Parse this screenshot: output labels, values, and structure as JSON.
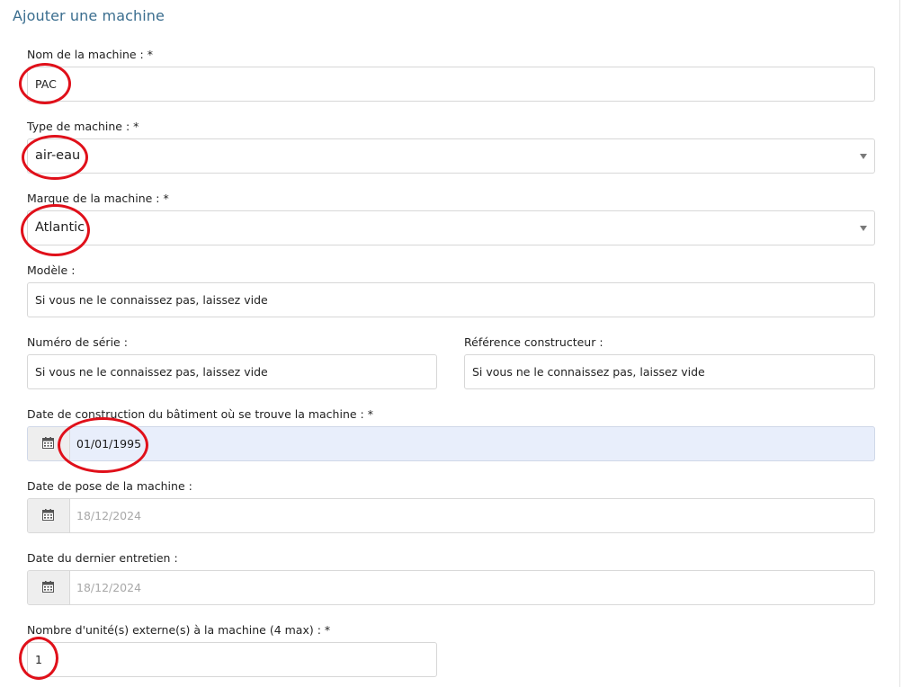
{
  "form": {
    "title": "Ajouter une machine",
    "name": {
      "label": "Nom de la machine : *",
      "value": "PAC"
    },
    "type": {
      "label": "Type de machine : *",
      "value": "air-eau"
    },
    "brand": {
      "label": "Marque de la machine : *",
      "value": "Atlantic"
    },
    "model": {
      "label": "Modèle :",
      "placeholder": "Si vous ne le connaissez pas, laissez vide"
    },
    "serial": {
      "label": "Numéro de série :",
      "placeholder": "Si vous ne le connaissez pas, laissez vide"
    },
    "ref": {
      "label": "Référence constructeur :",
      "placeholder": "Si vous ne le connaissez pas, laissez vide"
    },
    "build_date": {
      "label": "Date de construction du bâtiment où se trouve la machine : *",
      "value": "01/01/1995"
    },
    "install_date": {
      "label": "Date de pose de la machine :",
      "placeholder": "18/12/2024"
    },
    "service_date": {
      "label": "Date du dernier entretien :",
      "placeholder": "18/12/2024"
    },
    "units": {
      "label": "Nombre d'unité(s) externe(s) à la machine (4 max) : *",
      "value": "1"
    }
  },
  "icons": {
    "calendar": "calendar-icon",
    "dropdown": "caret-down-icon"
  },
  "colors": {
    "title": "#3b6e8f",
    "annotation": "#e0101a",
    "active_field": "#e8eefb"
  }
}
